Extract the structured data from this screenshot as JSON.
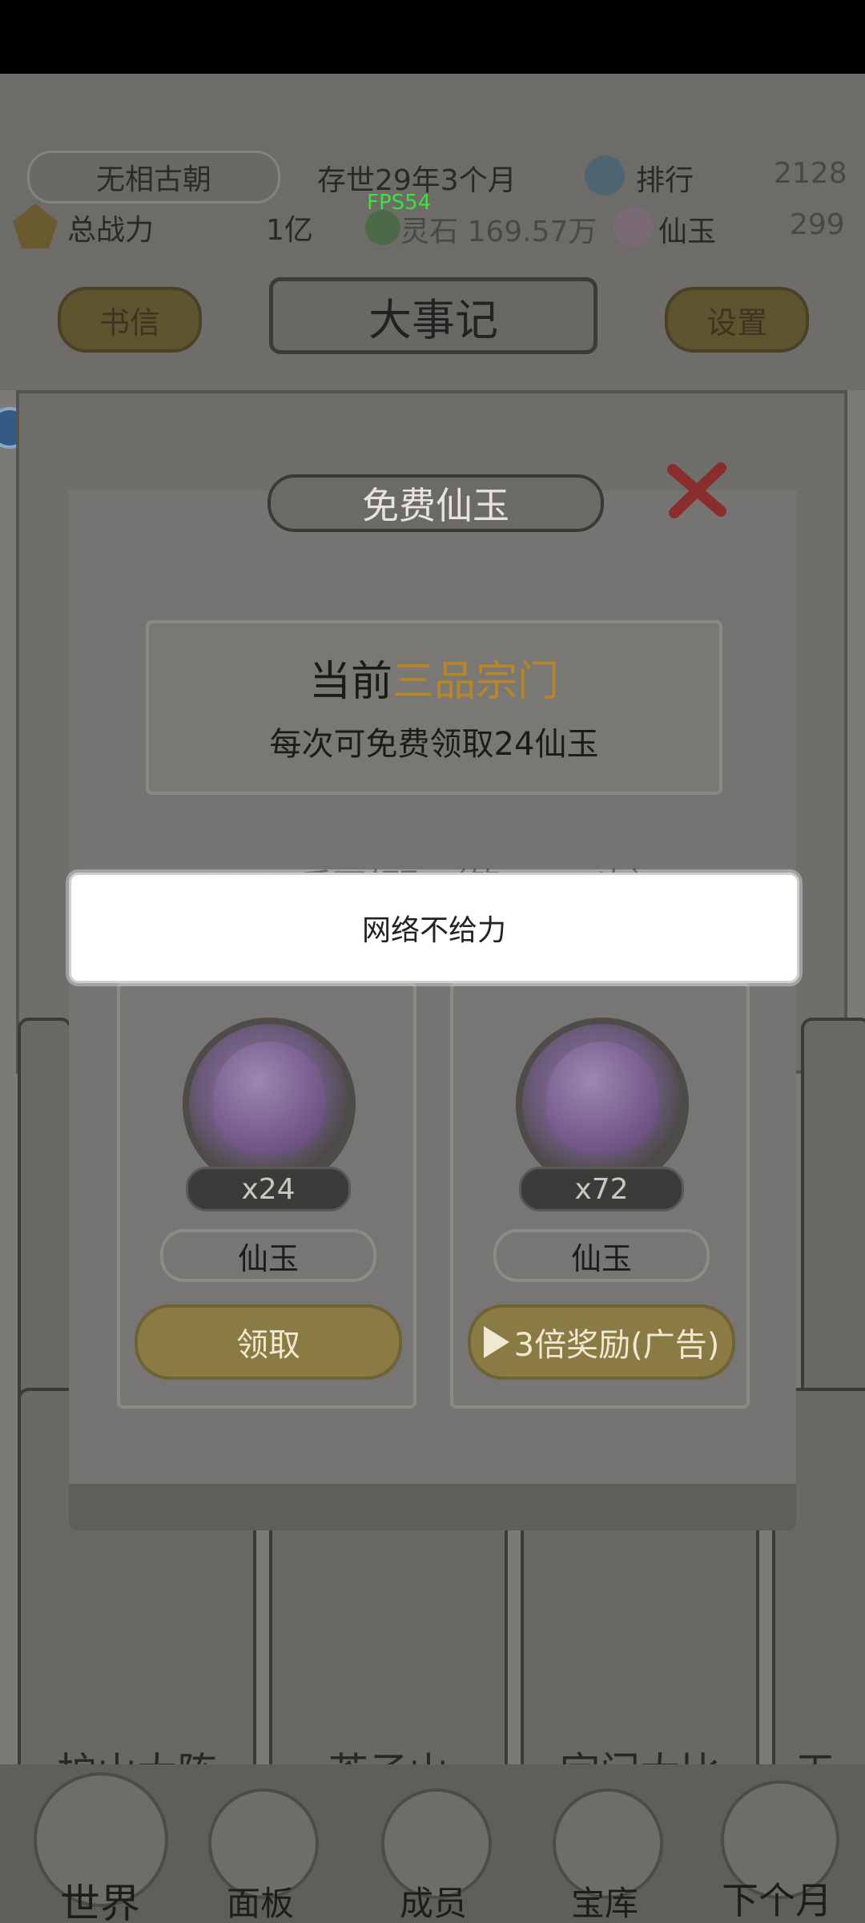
{
  "status_bar": {},
  "fps": "FPS54",
  "top": {
    "dynasty": "无相古朝",
    "age": "存世29年3个月",
    "rank_label": "排行",
    "rank_value": "2128",
    "power_label": "总战力",
    "power_value": "1亿",
    "stone_label": "灵石 169.57万",
    "jade_label": "仙玉",
    "jade_value": "299"
  },
  "header": {
    "left_button": "书信",
    "title": "大事记",
    "right_button": "设置"
  },
  "cards": [
    "护山大阵",
    "芥子山",
    "宗门大比",
    "天"
  ],
  "bottom_nav": [
    "世界",
    "面板",
    "成员",
    "宝库",
    "下个月"
  ],
  "modal": {
    "title": "免费仙玉",
    "info_prefix": "当前",
    "info_highlight": "三品宗门",
    "info_line2": "每次可免费领取24仙玉",
    "countdown": "00:00后可领取（第22/30次）",
    "rewards": [
      {
        "count": "x24",
        "name": "仙玉",
        "button": "领取"
      },
      {
        "count": "x72",
        "name": "仙玉",
        "button": "3倍奖励(广告)"
      }
    ]
  },
  "toast": "网络不给力",
  "colors": {
    "highlight": "#b8862a",
    "fps": "#3ce23c"
  }
}
